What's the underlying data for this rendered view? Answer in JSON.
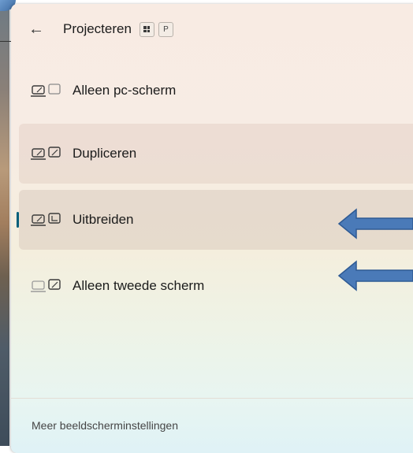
{
  "panel": {
    "title": "Projecteren",
    "shortcut_key": "P",
    "back_icon": "arrow-left-icon",
    "shortcut_icon": "windows-key-icon"
  },
  "options": [
    {
      "label": "Alleen pc-scherm",
      "icon": "pc-screen-only-icon",
      "state": "normal"
    },
    {
      "label": "Dupliceren",
      "icon": "duplicate-icon",
      "state": "hover"
    },
    {
      "label": "Uitbreiden",
      "icon": "extend-icon",
      "state": "selected"
    },
    {
      "label": "Alleen tweede scherm",
      "icon": "second-screen-only-icon",
      "state": "normal"
    }
  ],
  "annotations": {
    "arrow_color": "#4a7ab8"
  },
  "footer": {
    "link": "Meer beeldscherminstellingen"
  },
  "colors": {
    "selection_indicator": "#005f7a"
  }
}
